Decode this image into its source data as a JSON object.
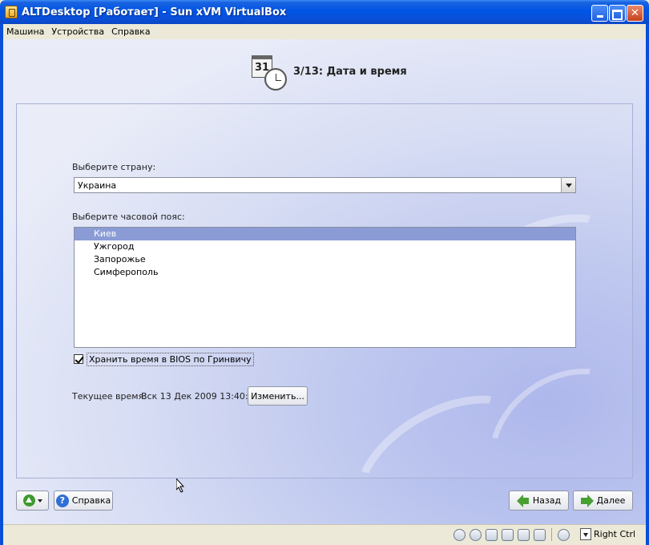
{
  "window": {
    "title": "ALTDesktop [Работает] - Sun xVM VirtualBox"
  },
  "menubar": {
    "items": [
      {
        "label": "Машина"
      },
      {
        "label": "Устройства"
      },
      {
        "label": "Справка"
      }
    ]
  },
  "installer": {
    "step_title": "3/13: Дата и время",
    "calendar_icon_text": "31",
    "country_label": "Выберите страну:",
    "country_value": "Украина",
    "timezone_label": "Выберите часовой пояс:",
    "timezones": [
      {
        "label": "Киев",
        "selected": true
      },
      {
        "label": "Ужгород",
        "selected": false
      },
      {
        "label": "Запорожье",
        "selected": false
      },
      {
        "label": "Симферополь",
        "selected": false
      }
    ],
    "bios_checkbox_label": "Хранить время в BIOS по Гринвичу",
    "bios_checked": true,
    "current_time_label": "Текущее время:",
    "current_time_value": "Вск 13 Дек 2009 13:40:58",
    "change_button": "Изменить...",
    "help_button": "Справка",
    "back_button": "Назад",
    "next_button": "Далее"
  },
  "statusbar": {
    "host_key_label": "Right Ctrl"
  },
  "colors": {
    "titlebar": "#0055e5",
    "selection": "#8a9bd6",
    "arrow_green": "#48a033"
  }
}
